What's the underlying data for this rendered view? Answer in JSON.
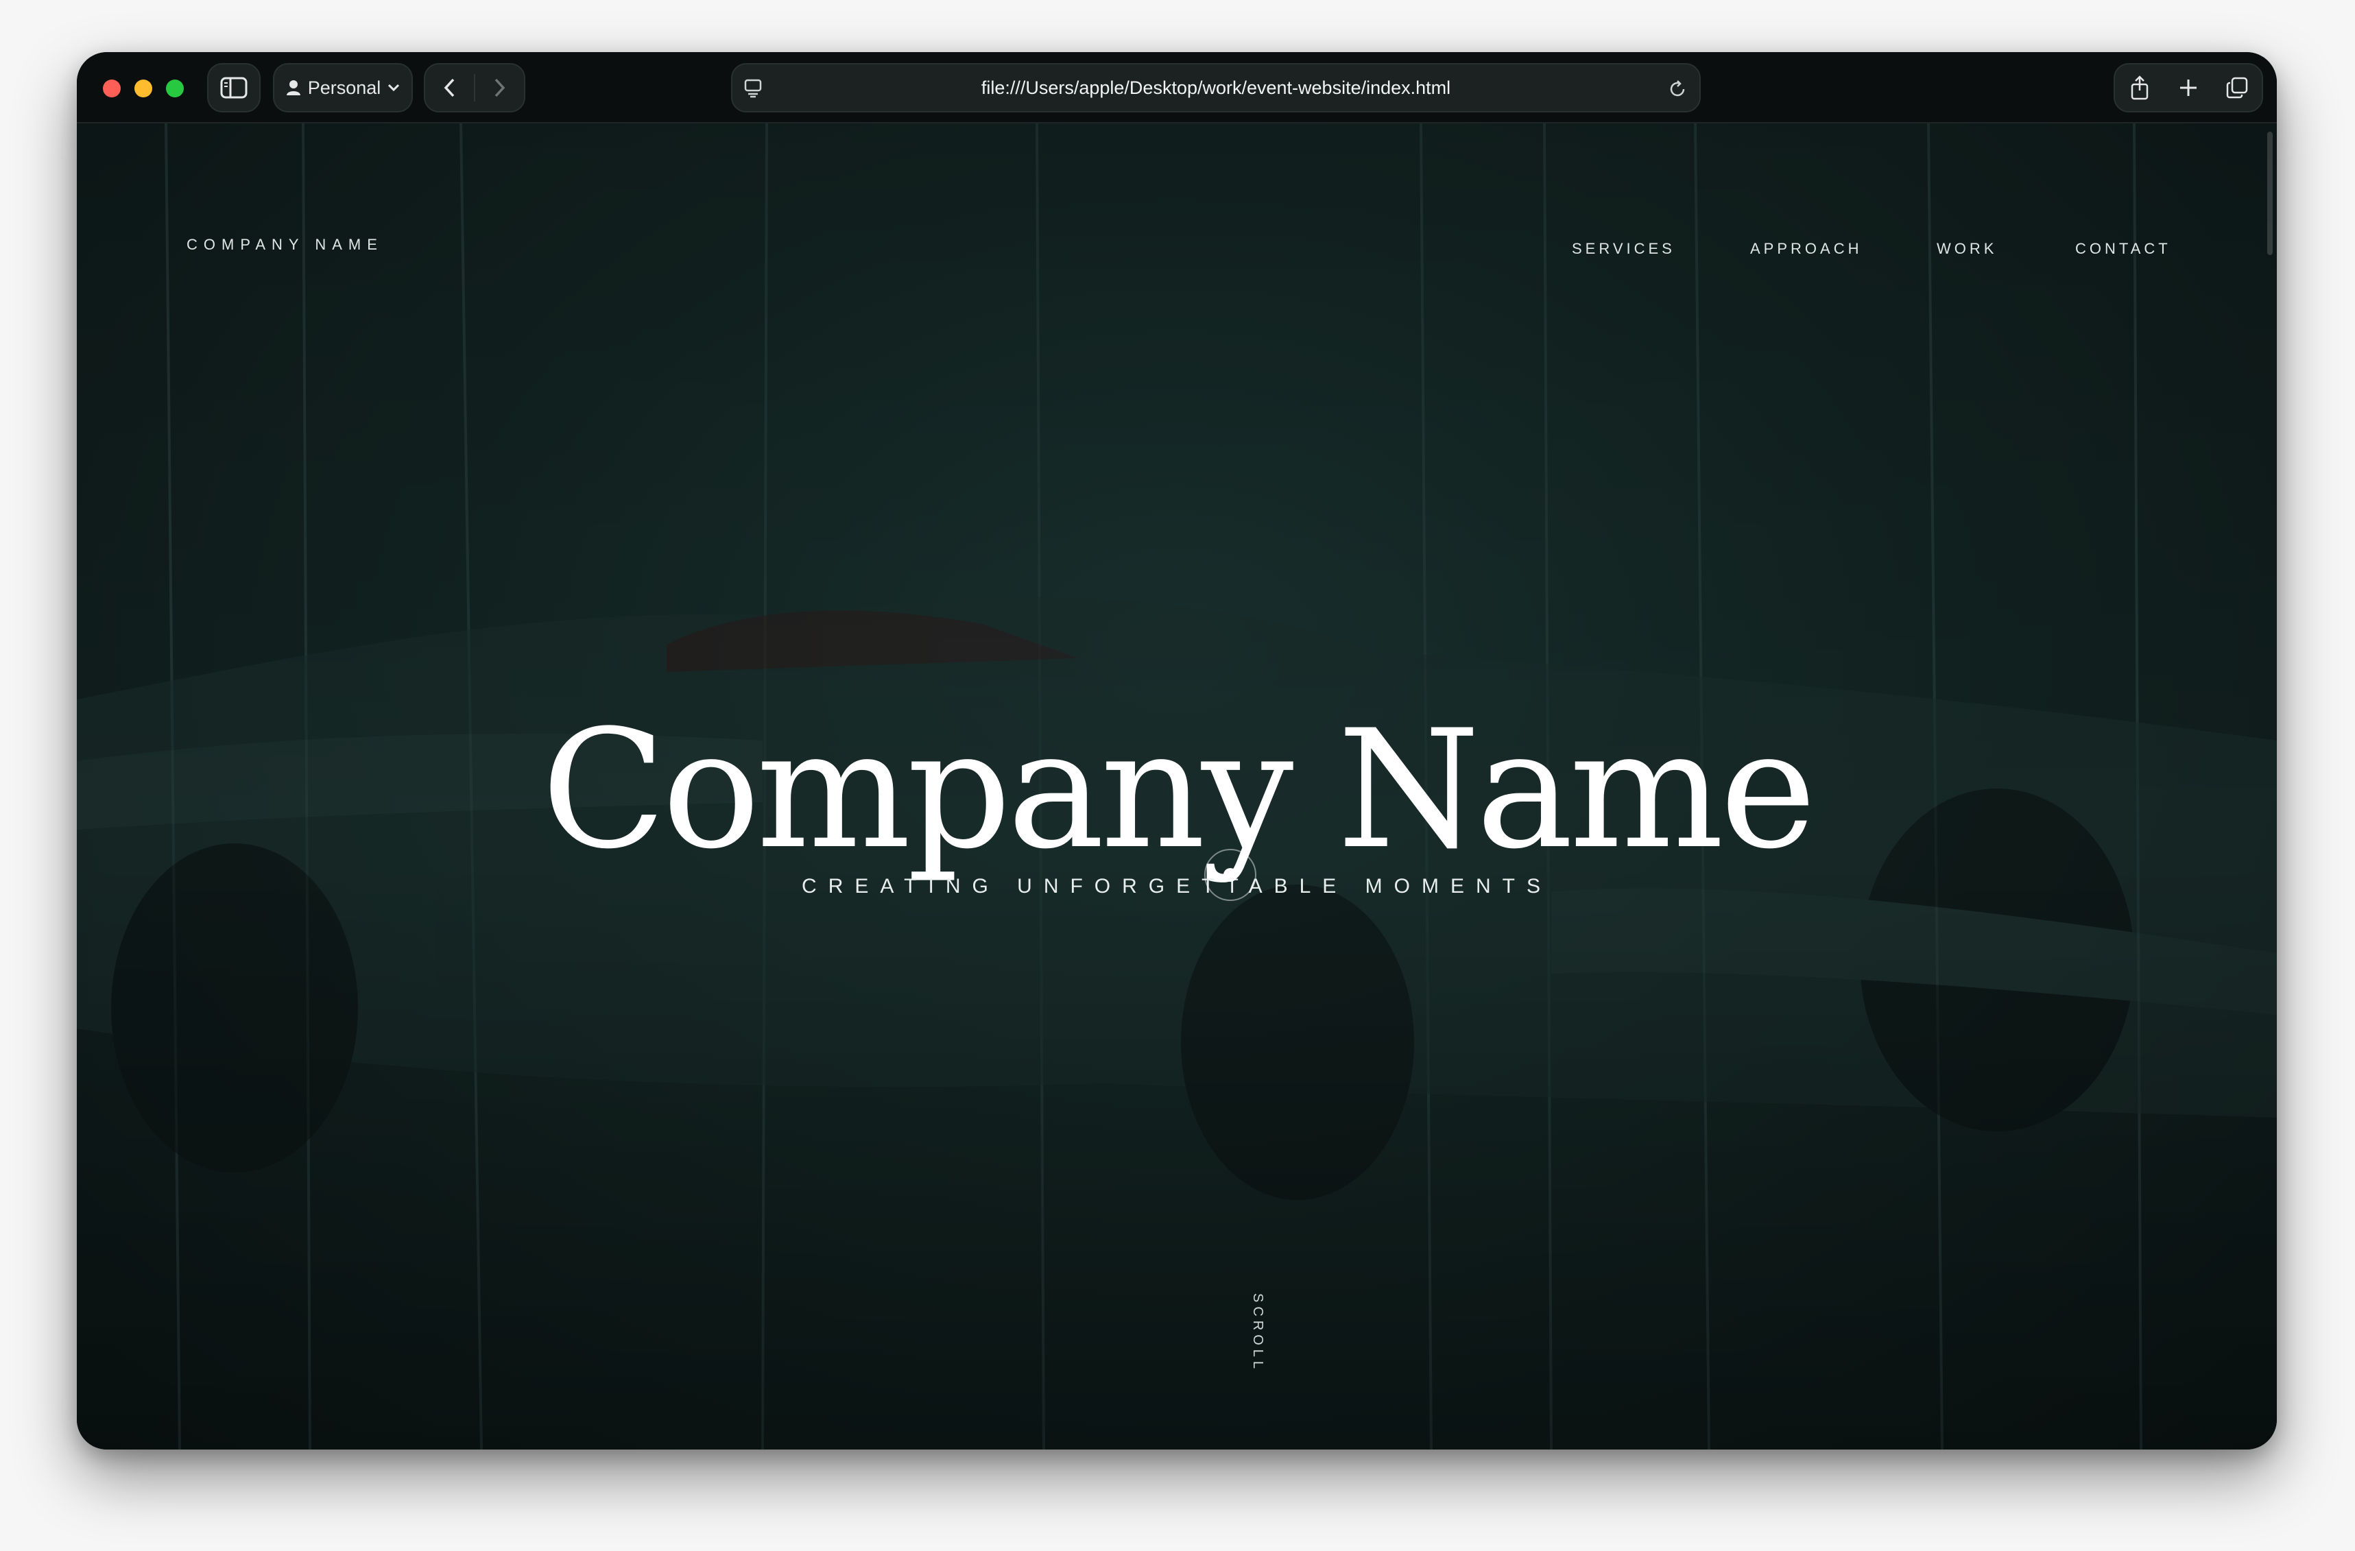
{
  "browser": {
    "profile_label": "Personal",
    "url": "file:///Users/apple/Desktop/work/event-website/index.html"
  },
  "site": {
    "logo": "COMPANY NAME",
    "nav": [
      "SERVICES",
      "APPROACH",
      "WORK",
      "CONTACT"
    ],
    "hero_title": "Company Name",
    "hero_subtitle": "CREATING UNFORGETTABLE MOMENTS",
    "scroll_label": "SCROLL"
  },
  "colors": {
    "background": "#0d1716",
    "text": "#ffffff",
    "traffic_close": "#ff5f57",
    "traffic_minimize": "#febc2e",
    "traffic_zoom": "#28c840"
  },
  "icons": [
    "sidebar-icon",
    "person-icon",
    "chevron-down-icon",
    "back-arrow-icon",
    "forward-arrow-icon",
    "site-settings-icon",
    "reload-icon",
    "share-icon",
    "plus-icon",
    "tabs-icon"
  ]
}
